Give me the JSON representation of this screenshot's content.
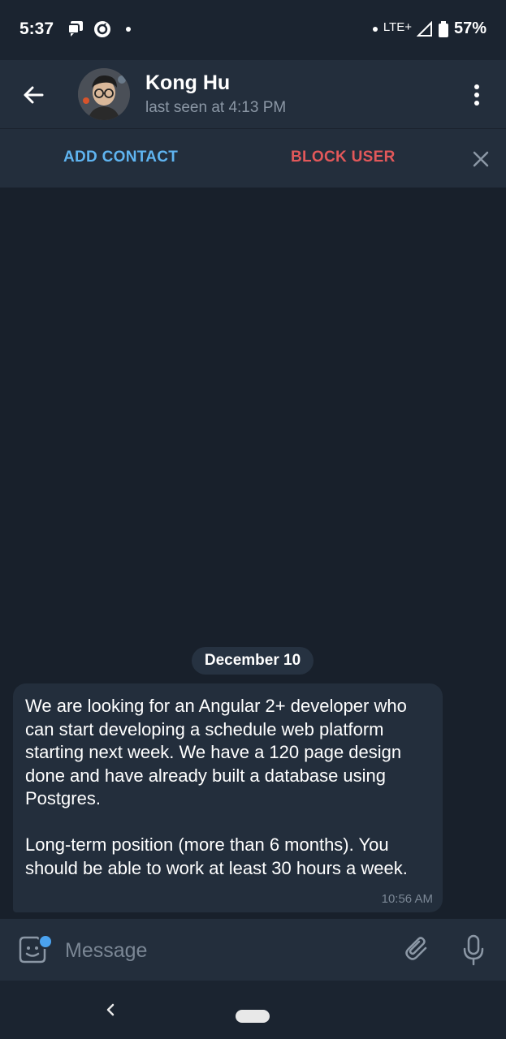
{
  "status_bar": {
    "time": "5:37",
    "network": "LTE+",
    "battery": "57%"
  },
  "header": {
    "contact_name": "Kong Hu",
    "last_seen": "last seen at 4:13 PM"
  },
  "action_bar": {
    "add_contact": "ADD CONTACT",
    "block_user": "BLOCK USER"
  },
  "chat": {
    "date_separator": "December 10",
    "messages": [
      {
        "text": "We are looking for an Angular 2+ developer who can start developing a schedule web platform starting next week. We have a 120 page design done and have already built a database using Postgres.\n\nLong-term position (more than 6 months). You should be able to work at least 30 hours a week.",
        "time": "10:56 AM"
      }
    ]
  },
  "composer": {
    "placeholder": "Message"
  },
  "colors": {
    "background": "#18202b",
    "bar": "#232e3c",
    "accent_blue": "#5fb4f0",
    "danger_red": "#e2585a"
  },
  "icons": [
    "back-arrow-icon",
    "more-vert-icon",
    "close-icon",
    "sticker-icon",
    "attach-icon",
    "mic-icon"
  ]
}
